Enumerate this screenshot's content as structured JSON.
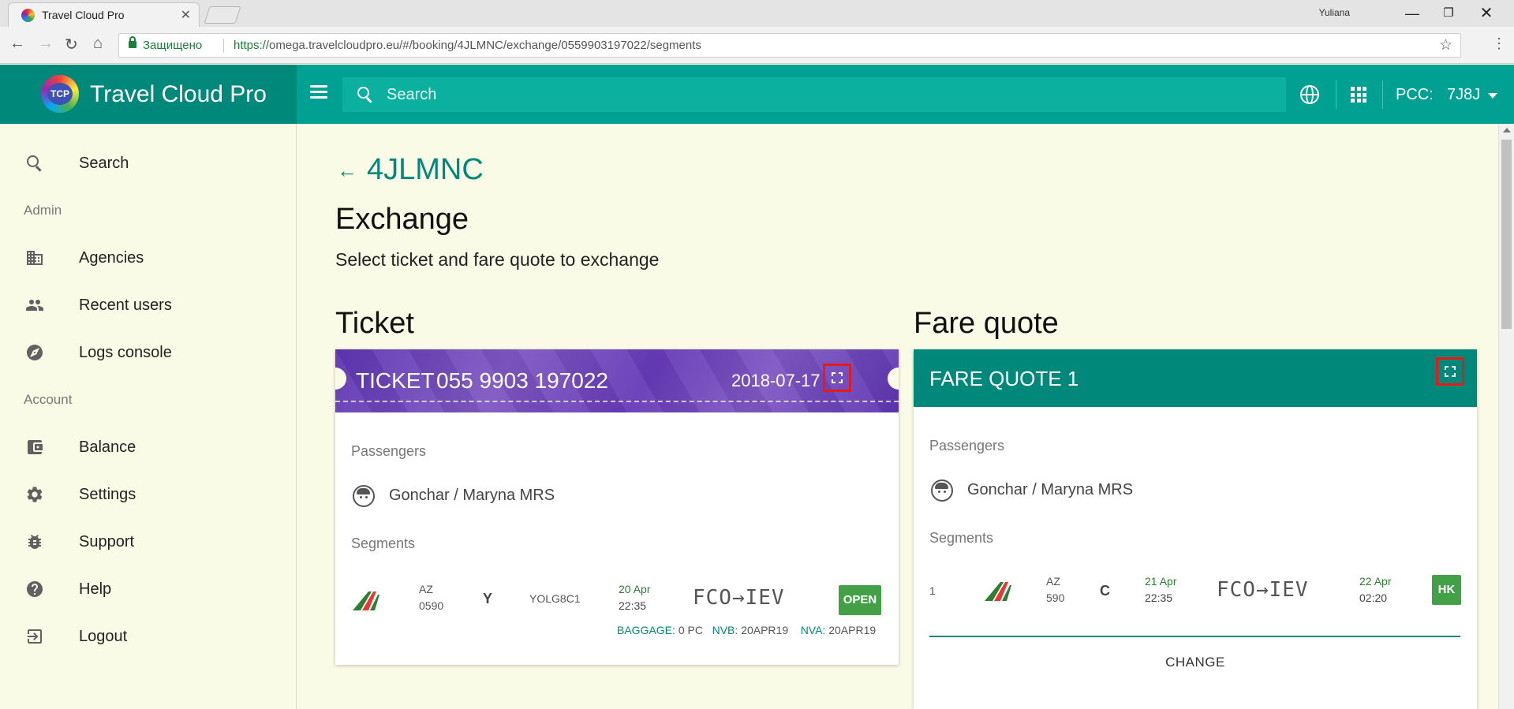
{
  "browser": {
    "tab_title": "Travel Cloud Pro",
    "user": "Yuliana",
    "secure_label": "Защищено",
    "url_scheme": "https://",
    "url_rest": "omega.travelcloudpro.eu/#/booking/4JLMNC/exchange/0559903197022/segments"
  },
  "header": {
    "brand": "Travel Cloud Pro",
    "logo_text": "TCP",
    "search_placeholder": "Search",
    "pcc_label": "PCC:",
    "pcc_value": "7J8J"
  },
  "sidebar": {
    "search": "Search",
    "section_admin": "Admin",
    "agencies": "Agencies",
    "recent_users": "Recent users",
    "logs_console": "Logs console",
    "section_account": "Account",
    "balance": "Balance",
    "settings": "Settings",
    "support": "Support",
    "help": "Help",
    "logout": "Logout"
  },
  "main": {
    "pnr": "4JLMNC",
    "title": "Exchange",
    "subtitle": "Select ticket and fare quote to exchange",
    "ticket_heading": "Ticket",
    "fare_heading": "Fare quote"
  },
  "ticket": {
    "label": "TICKET",
    "number": "055 9903 197022",
    "date": "2018-07-17",
    "passengers_label": "Passengers",
    "passenger": "Gonchar / Maryna MRS",
    "segments_label": "Segments",
    "segment": {
      "carrier": "AZ",
      "flight": "0590",
      "class": "Y",
      "fare_basis": "YOLG8C1",
      "dep_date": "20 Apr",
      "dep_time": "22:35",
      "route": "FCO→IEV",
      "status": "OPEN",
      "baggage_label": "BAGGAGE:",
      "baggage": "0 PC",
      "nvb_label": "NVB:",
      "nvb": "20APR19",
      "nva_label": "NVA:",
      "nva": "20APR19"
    }
  },
  "fare_quote": {
    "title": "FARE QUOTE 1",
    "passengers_label": "Passengers",
    "passenger": "Gonchar / Maryna MRS",
    "segments_label": "Segments",
    "segment": {
      "index": "1",
      "carrier": "AZ",
      "flight": "590",
      "class": "C",
      "dep_date": "21 Apr",
      "dep_time": "22:35",
      "route": "FCO→IEV",
      "arr_date": "22 Apr",
      "arr_time": "02:20",
      "status": "HK"
    },
    "change_label": "CHANGE"
  },
  "colors": {
    "brand_dark": "#00897b",
    "brand": "#00a193",
    "ticket_purple": "#673ab7",
    "status_green": "#43a047",
    "highlight_red": "#e31b1b"
  }
}
